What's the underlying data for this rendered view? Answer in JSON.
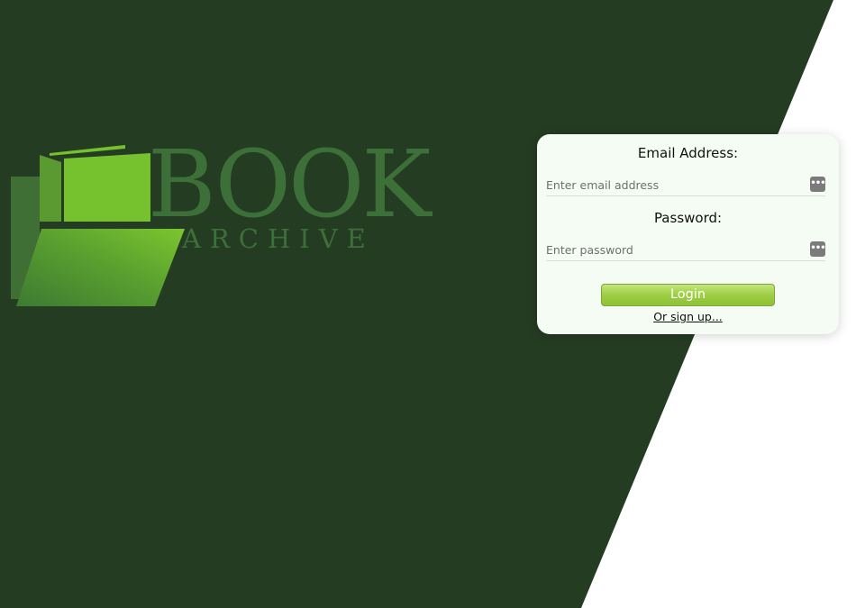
{
  "colors": {
    "background_dark": "#243c22",
    "background_light": "#ffffff",
    "logo_text": "#3d6f38",
    "book_green_light": "#76c12e",
    "book_green_dark": "#3f6f34",
    "card_background": "#f5fcf3",
    "login_button": "#9dcd43"
  },
  "logo": {
    "word_main": "BOOK",
    "word_sub": "ARCHIVE"
  },
  "login": {
    "email_label": "Email Address:",
    "email_placeholder": "Enter email address",
    "email_value": "",
    "password_label": "Password:",
    "password_placeholder": "Enter password",
    "password_value": "",
    "key_icon_glyph": "•••",
    "button_label": "Login",
    "signup_link": "Or sign up..."
  }
}
